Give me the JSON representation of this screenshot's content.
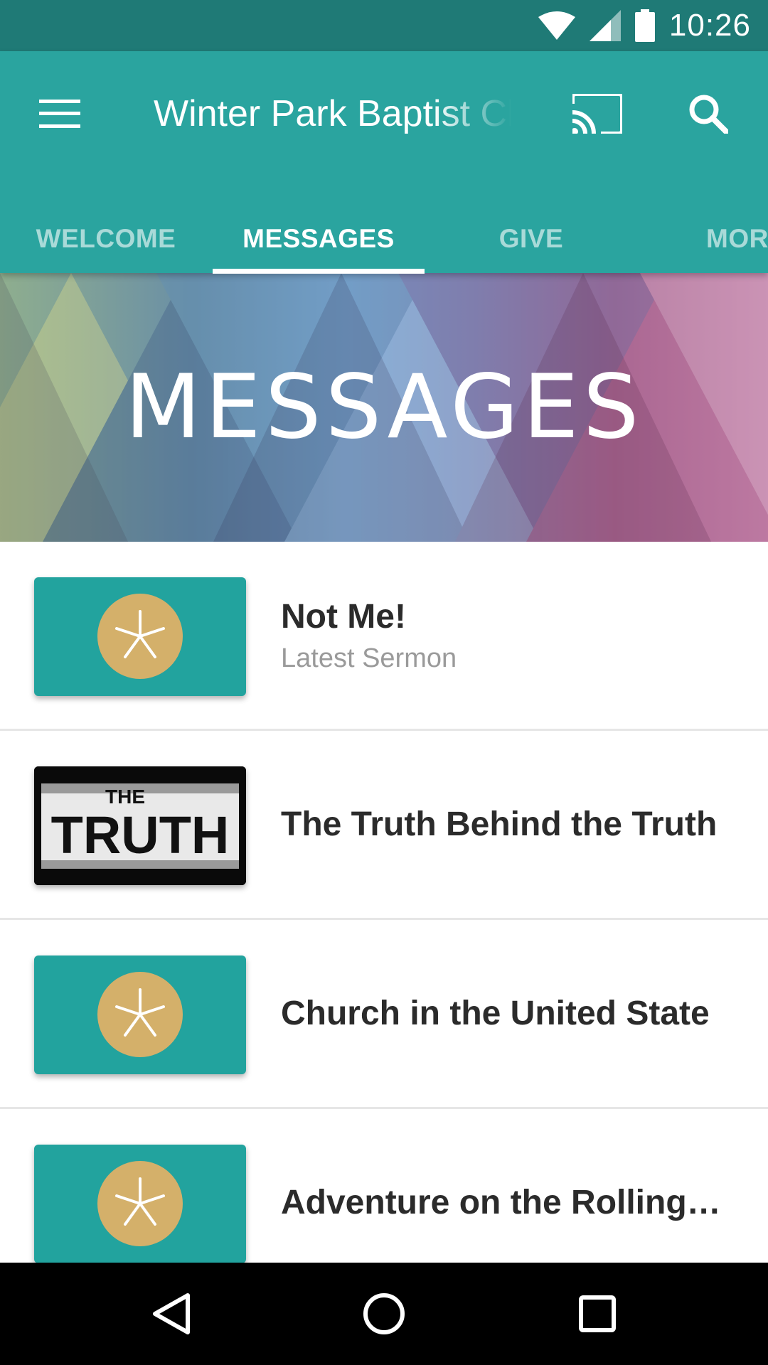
{
  "status_bar": {
    "time": "10:26"
  },
  "app_bar": {
    "title": "Winter Park Baptist Church",
    "icons": {
      "menu": "menu-icon",
      "cast": "cast-icon",
      "search": "search-icon"
    }
  },
  "tabs": [
    {
      "label": "WELCOME",
      "active": false
    },
    {
      "label": "MESSAGES",
      "active": true
    },
    {
      "label": "GIVE",
      "active": false
    },
    {
      "label": "MORE",
      "active": false
    }
  ],
  "hero": {
    "title": "MESSAGES"
  },
  "messages": [
    {
      "title": "Not Me!",
      "subtitle": "Latest Sermon",
      "thumbnail": "sand-dollar"
    },
    {
      "title": "The Truth Behind the Truth",
      "subtitle": "",
      "thumbnail": "the-truth"
    },
    {
      "title": "Church in the United State",
      "subtitle": "",
      "thumbnail": "sand-dollar"
    },
    {
      "title": "Adventure on the Rolling…",
      "subtitle": "",
      "thumbnail": "sand-dollar"
    }
  ],
  "thumb_truth": {
    "small": "THE",
    "big": "TRUTH"
  },
  "colors": {
    "primary": "#2aa49f",
    "primary_dark": "#1f7a76",
    "thumb_bg": "#22a39e",
    "sand_dollar": "#d4b06a"
  },
  "nav_bar": {
    "back": "back-icon",
    "home": "home-icon",
    "recents": "recents-icon"
  }
}
